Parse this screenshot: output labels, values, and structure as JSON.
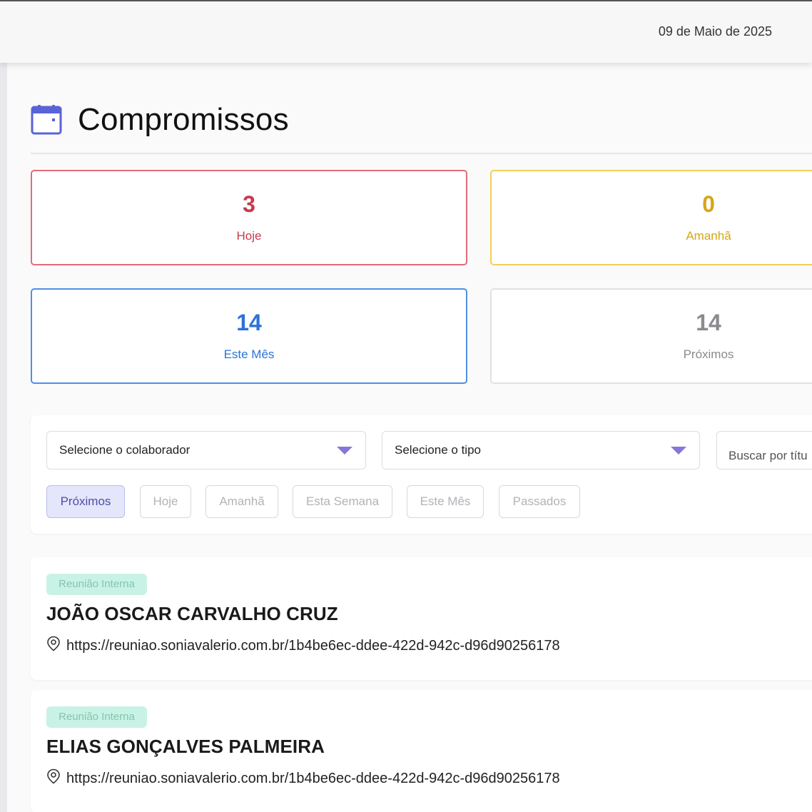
{
  "header": {
    "date": "09 de Maio de 2025"
  },
  "page": {
    "title": "Compromissos",
    "title_icon": "calendar-icon"
  },
  "stats": [
    {
      "value": "3",
      "label": "Hoje",
      "color": "#c73a4c"
    },
    {
      "value": "0",
      "label": "Amanhã",
      "color": "#d5a61a"
    },
    {
      "value": "14",
      "label": "Este Mês",
      "color": "#2a73d9"
    },
    {
      "value": "14",
      "label": "Próximos",
      "color": "#8a8a90"
    }
  ],
  "filters": {
    "collaborator_select": "Selecione o colaborador",
    "type_select": "Selecione o tipo",
    "search_text": "Buscar por títu",
    "chips": [
      {
        "label": "Próximos",
        "active": true
      },
      {
        "label": "Hoje",
        "active": false
      },
      {
        "label": "Amanhã",
        "active": false
      },
      {
        "label": "Esta Semana",
        "active": false
      },
      {
        "label": "Este Mês",
        "active": false
      },
      {
        "label": "Passados",
        "active": false
      }
    ]
  },
  "events": [
    {
      "type": "Reunião Interna",
      "name": "JOÃO OSCAR CARVALHO CRUZ",
      "location": "https://reuniao.soniavalerio.com.br/1b4be6ec-ddee-422d-942c-d96d90256178"
    },
    {
      "type": "Reunião Interna",
      "name": "ELIAS GONÇALVES PALMEIRA",
      "location": "https://reuniao.soniavalerio.com.br/1b4be6ec-ddee-422d-942c-d96d90256178"
    }
  ]
}
